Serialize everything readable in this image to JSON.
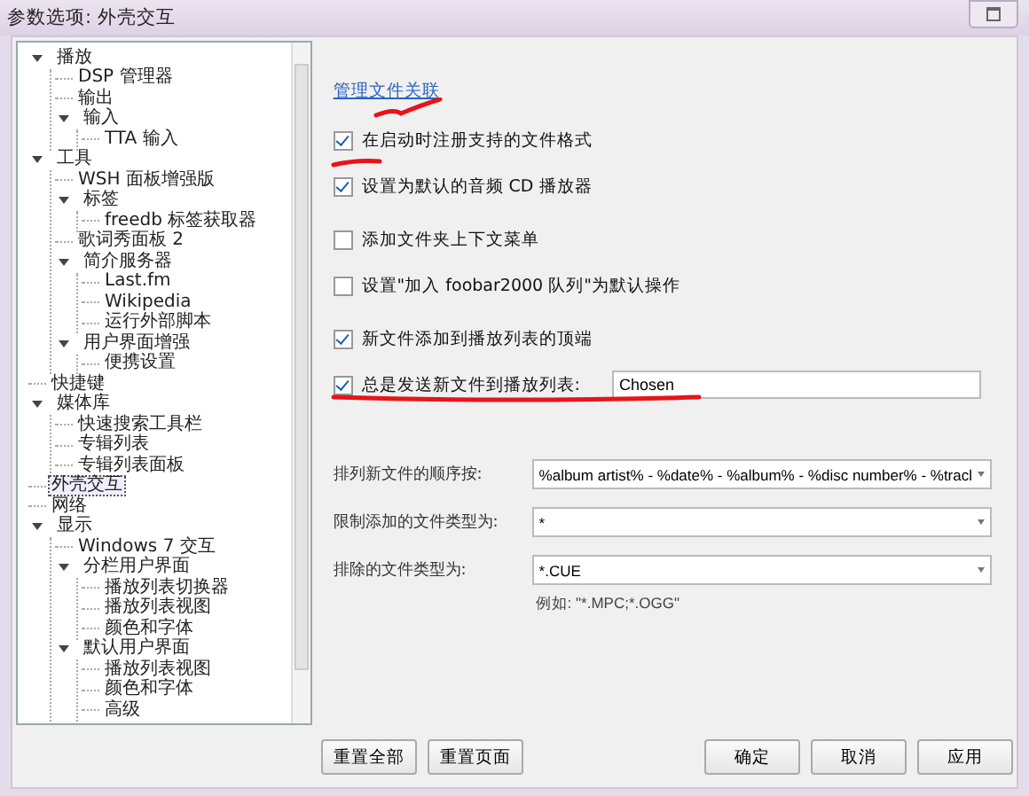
{
  "window": {
    "title": "参数选项: 外壳交互"
  },
  "tree": [
    {
      "label": "播放",
      "expanded": true,
      "selected": false,
      "children": [
        {
          "label": "DSP 管理器",
          "selected": false
        },
        {
          "label": "输出",
          "selected": false
        },
        {
          "label": "输入",
          "expanded": true,
          "selected": false,
          "children": [
            {
              "label": "TTA 输入",
              "selected": false
            }
          ]
        }
      ]
    },
    {
      "label": "工具",
      "expanded": true,
      "selected": false,
      "children": [
        {
          "label": "WSH 面板增强版",
          "selected": false
        },
        {
          "label": "标签",
          "expanded": true,
          "selected": false,
          "children": [
            {
              "label": "freedb 标签获取器",
              "selected": false
            }
          ]
        },
        {
          "label": "歌词秀面板 2",
          "selected": false
        },
        {
          "label": "简介服务器",
          "expanded": true,
          "selected": false,
          "children": [
            {
              "label": "Last.fm",
              "selected": false
            },
            {
              "label": "Wikipedia",
              "selected": false
            },
            {
              "label": "运行外部脚本",
              "selected": false
            }
          ]
        },
        {
          "label": "用户界面增强",
          "expanded": true,
          "selected": false,
          "children": [
            {
              "label": "便携设置",
              "selected": false
            }
          ]
        }
      ]
    },
    {
      "label": "快捷键",
      "selected": false
    },
    {
      "label": "媒体库",
      "expanded": true,
      "selected": false,
      "children": [
        {
          "label": "快速搜索工具栏",
          "selected": false
        },
        {
          "label": "专辑列表",
          "selected": false
        },
        {
          "label": "专辑列表面板",
          "selected": false
        }
      ]
    },
    {
      "label": "外壳交互",
      "selected": true
    },
    {
      "label": "网络",
      "selected": false
    },
    {
      "label": "显示",
      "expanded": true,
      "selected": false,
      "children": [
        {
          "label": "Windows 7 交互",
          "selected": false
        },
        {
          "label": "分栏用户界面",
          "expanded": true,
          "selected": false,
          "children": [
            {
              "label": "播放列表切换器",
              "selected": false
            },
            {
              "label": "播放列表视图",
              "selected": false
            },
            {
              "label": "颜色和字体",
              "selected": false
            }
          ]
        },
        {
          "label": "默认用户界面",
          "expanded": true,
          "selected": false,
          "children": [
            {
              "label": "播放列表视图",
              "selected": false
            },
            {
              "label": "颜色和字体",
              "selected": false
            },
            {
              "label": "高级",
              "selected": false
            }
          ]
        }
      ]
    }
  ],
  "link": "管理文件关联",
  "option_groups": [
    [
      {
        "kind": "checkbox",
        "label": "在启动时注册支持的文件格式",
        "checked": true
      },
      {
        "kind": "checkbox",
        "label": "设置为默认的音频 CD 播放器",
        "checked": true
      }
    ],
    [
      {
        "kind": "checkbox",
        "label": "添加文件夹上下文菜单",
        "checked": false
      },
      {
        "kind": "checkbox",
        "label": "设置\"加入 foobar2000 队列\"为默认操作",
        "checked": false
      }
    ],
    [
      {
        "kind": "checkbox",
        "label": "新文件添加到播放列表的顶端",
        "checked": true
      },
      {
        "kind": "checkbox-field",
        "label": "总是发送新文件到播放列表:",
        "checked": true,
        "value": "Chosen"
      }
    ]
  ],
  "dropdowns": [
    {
      "label": "排列新文件的顺序按:",
      "value": "%album artist% - %date% - %album% - %disc number% - %tracl"
    },
    {
      "label": "限制添加的文件类型为:",
      "value": "*"
    },
    {
      "label": "排除的文件类型为:",
      "value": "*.CUE",
      "hint": "例如: \"*.MPC;*.OGG\""
    }
  ],
  "left_buttons": [
    "重置全部",
    "重置页面"
  ],
  "right_buttons": [
    "确定",
    "取消",
    "应用"
  ]
}
